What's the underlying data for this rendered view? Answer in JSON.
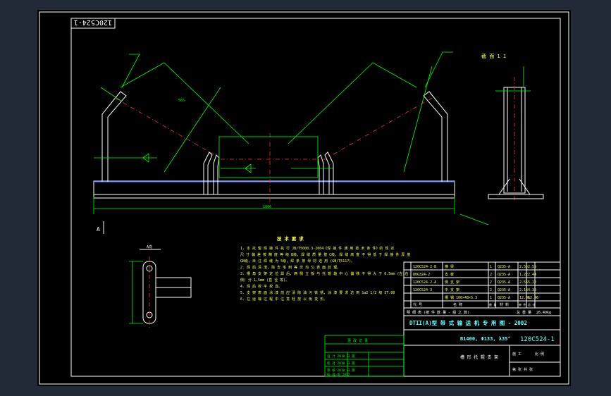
{
  "drawing": {
    "stamp_top_left": "120C524-1",
    "section_label": "截 面 1 1",
    "view_label_a": "A",
    "view_label_a2": "A向",
    "dim_total": "1800",
    "dim_roll": "565"
  },
  "tech_requirements": {
    "title": "技 术 要 求",
    "items": [
      "1. 本 托 辊 焊 接 件 执 行 JB/T5000.3-2004《焊 接 件 通 用 技 术 条 件》的 规 定",
      "   尺 寸 偏 差 按 精 度 等 级 B级, 焊 缝 质 量 按 C级, 焊 缝 高 度 不 得 低 于 焊 接 件 厚 度",
      "   GB级, 未 注 焊 缝 为 5级, 焊 条 按 母 材 选 用 (GB/T5117)。",
      "2. 焊 后 清 渣, 除 去 毛 刺 等 非 均 匀 表 面 处 理。",
      "3. 槽 角 支 架 定 位 焊 后, 两 侧 立 板 与 托 辊 轴 中 心 偏 移 不 得 大 于 0.5mm (左 右",
      "   侧) 分 1.5mm (直 径 等)。",
      "4. 焊 后 校 平 校 直。",
      "5. 支 架 表 面 涂 漆 前 应 清 除 油 污 铁 锈, 涂 漆 要 求 达 到 Sa2 1/2 级 ST.00",
      "6. 在 运 输 过 程 中 注 意 轻 放 以 免 变 形。"
    ]
  },
  "parts_list": {
    "rows": [
      {
        "code": "120C524-2-B",
        "name": "横 梁",
        "qty": "1",
        "mat": "Q235-A",
        "w1": "2.55",
        "w2": "2.55"
      },
      {
        "code": "80G324-2",
        "name": "支 板",
        "qty": "2",
        "mat": "Q235-A",
        "w1": "1.22",
        "w2": "2.44"
      },
      {
        "code": "120C524-2-A",
        "name": "侧 支 架",
        "qty": "2",
        "mat": "Q235-A",
        "w1": "2.56",
        "w2": "5.12"
      },
      {
        "code": "120C524-3",
        "name": "中 支 架",
        "qty": "2",
        "mat": "Q235-A",
        "w1": "2.16",
        "w2": "4.32"
      },
      {
        "code": "",
        "name": "槽 钢 100×48×5.3",
        "qty": "1",
        "mat": "Q235-A",
        "w1": "12.06",
        "w2": "12.06"
      }
    ],
    "header": [
      "代 号",
      "名 称",
      "数 量",
      "材 料",
      "单 件",
      "总 计"
    ],
    "footer_left": "明 细 表 (按 件 数 量 - 组 之 数)",
    "footer_right": "总 重 量",
    "total_weight": "26.49kg"
  },
  "title_block": {
    "series": "DTII(A)型 带 式 输 送 机 专 用 图 - 2002",
    "spec": "B1400, Φ133, λ35°",
    "drawing_no": "120C524-1",
    "part_name": "槽 形 托 辊 支 架",
    "stage": "施 工",
    "scale": "比 例",
    "sheet": "第 张 共 张"
  },
  "revision_table": {
    "title": "更 改 记 录",
    "rows": [
      "设 计  2010  日 期",
      "校 对  2010  日 期",
      "审 核  2010  日 期",
      "标 准 化  2017"
    ]
  }
}
